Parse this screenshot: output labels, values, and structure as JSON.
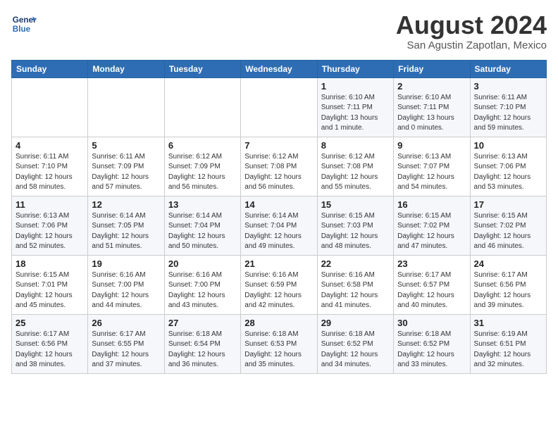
{
  "logo": {
    "line1": "General",
    "line2": "Blue"
  },
  "title": "August 2024",
  "location": "San Agustin Zapotlan, Mexico",
  "days_of_week": [
    "Sunday",
    "Monday",
    "Tuesday",
    "Wednesday",
    "Thursday",
    "Friday",
    "Saturday"
  ],
  "weeks": [
    [
      {
        "day": "",
        "info": ""
      },
      {
        "day": "",
        "info": ""
      },
      {
        "day": "",
        "info": ""
      },
      {
        "day": "",
        "info": ""
      },
      {
        "day": "1",
        "info": "Sunrise: 6:10 AM\nSunset: 7:11 PM\nDaylight: 13 hours\nand 1 minute."
      },
      {
        "day": "2",
        "info": "Sunrise: 6:10 AM\nSunset: 7:11 PM\nDaylight: 13 hours\nand 0 minutes."
      },
      {
        "day": "3",
        "info": "Sunrise: 6:11 AM\nSunset: 7:10 PM\nDaylight: 12 hours\nand 59 minutes."
      }
    ],
    [
      {
        "day": "4",
        "info": "Sunrise: 6:11 AM\nSunset: 7:10 PM\nDaylight: 12 hours\nand 58 minutes."
      },
      {
        "day": "5",
        "info": "Sunrise: 6:11 AM\nSunset: 7:09 PM\nDaylight: 12 hours\nand 57 minutes."
      },
      {
        "day": "6",
        "info": "Sunrise: 6:12 AM\nSunset: 7:09 PM\nDaylight: 12 hours\nand 56 minutes."
      },
      {
        "day": "7",
        "info": "Sunrise: 6:12 AM\nSunset: 7:08 PM\nDaylight: 12 hours\nand 56 minutes."
      },
      {
        "day": "8",
        "info": "Sunrise: 6:12 AM\nSunset: 7:08 PM\nDaylight: 12 hours\nand 55 minutes."
      },
      {
        "day": "9",
        "info": "Sunrise: 6:13 AM\nSunset: 7:07 PM\nDaylight: 12 hours\nand 54 minutes."
      },
      {
        "day": "10",
        "info": "Sunrise: 6:13 AM\nSunset: 7:06 PM\nDaylight: 12 hours\nand 53 minutes."
      }
    ],
    [
      {
        "day": "11",
        "info": "Sunrise: 6:13 AM\nSunset: 7:06 PM\nDaylight: 12 hours\nand 52 minutes."
      },
      {
        "day": "12",
        "info": "Sunrise: 6:14 AM\nSunset: 7:05 PM\nDaylight: 12 hours\nand 51 minutes."
      },
      {
        "day": "13",
        "info": "Sunrise: 6:14 AM\nSunset: 7:04 PM\nDaylight: 12 hours\nand 50 minutes."
      },
      {
        "day": "14",
        "info": "Sunrise: 6:14 AM\nSunset: 7:04 PM\nDaylight: 12 hours\nand 49 minutes."
      },
      {
        "day": "15",
        "info": "Sunrise: 6:15 AM\nSunset: 7:03 PM\nDaylight: 12 hours\nand 48 minutes."
      },
      {
        "day": "16",
        "info": "Sunrise: 6:15 AM\nSunset: 7:02 PM\nDaylight: 12 hours\nand 47 minutes."
      },
      {
        "day": "17",
        "info": "Sunrise: 6:15 AM\nSunset: 7:02 PM\nDaylight: 12 hours\nand 46 minutes."
      }
    ],
    [
      {
        "day": "18",
        "info": "Sunrise: 6:15 AM\nSunset: 7:01 PM\nDaylight: 12 hours\nand 45 minutes."
      },
      {
        "day": "19",
        "info": "Sunrise: 6:16 AM\nSunset: 7:00 PM\nDaylight: 12 hours\nand 44 minutes."
      },
      {
        "day": "20",
        "info": "Sunrise: 6:16 AM\nSunset: 7:00 PM\nDaylight: 12 hours\nand 43 minutes."
      },
      {
        "day": "21",
        "info": "Sunrise: 6:16 AM\nSunset: 6:59 PM\nDaylight: 12 hours\nand 42 minutes."
      },
      {
        "day": "22",
        "info": "Sunrise: 6:16 AM\nSunset: 6:58 PM\nDaylight: 12 hours\nand 41 minutes."
      },
      {
        "day": "23",
        "info": "Sunrise: 6:17 AM\nSunset: 6:57 PM\nDaylight: 12 hours\nand 40 minutes."
      },
      {
        "day": "24",
        "info": "Sunrise: 6:17 AM\nSunset: 6:56 PM\nDaylight: 12 hours\nand 39 minutes."
      }
    ],
    [
      {
        "day": "25",
        "info": "Sunrise: 6:17 AM\nSunset: 6:56 PM\nDaylight: 12 hours\nand 38 minutes."
      },
      {
        "day": "26",
        "info": "Sunrise: 6:17 AM\nSunset: 6:55 PM\nDaylight: 12 hours\nand 37 minutes."
      },
      {
        "day": "27",
        "info": "Sunrise: 6:18 AM\nSunset: 6:54 PM\nDaylight: 12 hours\nand 36 minutes."
      },
      {
        "day": "28",
        "info": "Sunrise: 6:18 AM\nSunset: 6:53 PM\nDaylight: 12 hours\nand 35 minutes."
      },
      {
        "day": "29",
        "info": "Sunrise: 6:18 AM\nSunset: 6:52 PM\nDaylight: 12 hours\nand 34 minutes."
      },
      {
        "day": "30",
        "info": "Sunrise: 6:18 AM\nSunset: 6:52 PM\nDaylight: 12 hours\nand 33 minutes."
      },
      {
        "day": "31",
        "info": "Sunrise: 6:19 AM\nSunset: 6:51 PM\nDaylight: 12 hours\nand 32 minutes."
      }
    ]
  ]
}
